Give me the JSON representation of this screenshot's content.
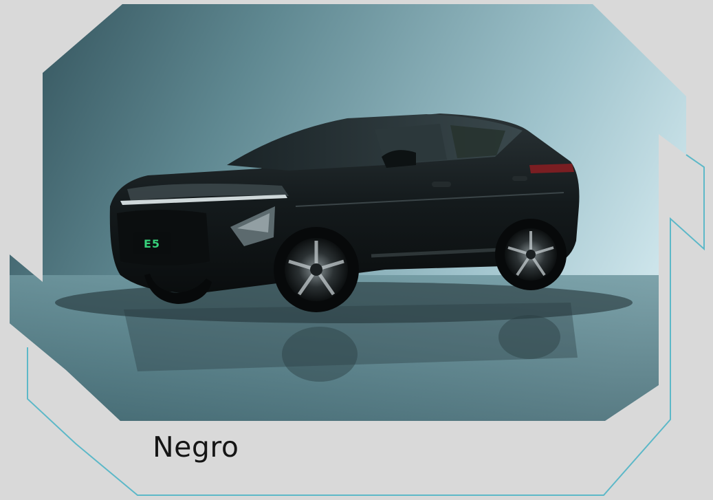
{
  "variant": {
    "color_name": "Negro",
    "badge_text": "E5"
  },
  "colors": {
    "page_bg": "#d9d9d9",
    "outline_accent": "#5cb8c8",
    "car_body": "#111618",
    "badge_green": "#37d07a"
  },
  "image": {
    "subject": "black-suv-photo",
    "background": "teal-gradient-studio"
  }
}
